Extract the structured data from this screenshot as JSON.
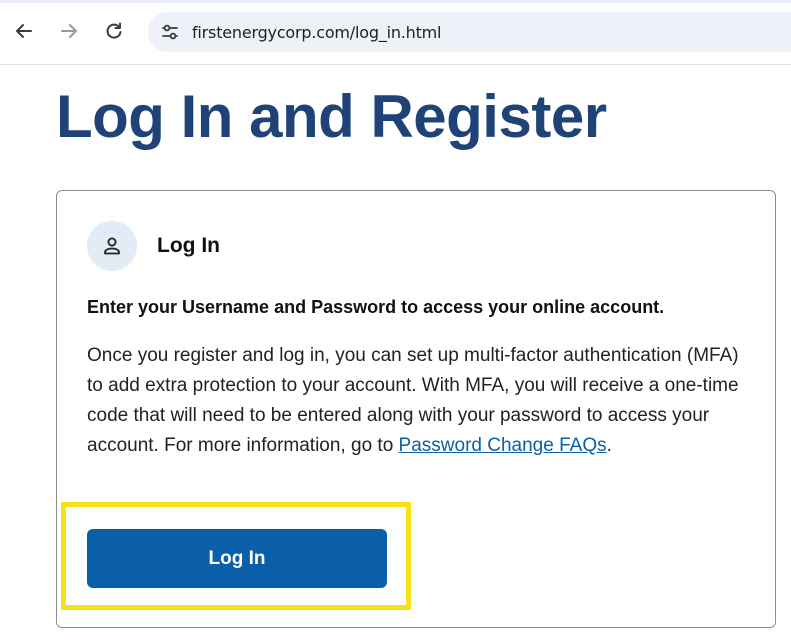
{
  "browser": {
    "url": "firstenergycorp.com/log_in.html",
    "icons": [
      "back-icon",
      "forward-icon",
      "reload-icon",
      "site-info-icon"
    ]
  },
  "page": {
    "title": "Log In and Register"
  },
  "card": {
    "icon": "user-icon",
    "heading": "Log In",
    "subheading": "Enter your Username and Password to access your online account.",
    "body_text": "Once you register and log in, you can set up multi-factor authentication (MFA) to add extra protection to your account. With MFA, you will receive a one-time code that will need to be entered along with your password to access your account. For more information, go to ",
    "link_text": "Password Change FAQs",
    "body_end": ".",
    "button_label": "Log In"
  },
  "colors": {
    "title": "#1f4277",
    "button": "#0a5fa8",
    "link": "#0b5fa5",
    "highlight": "#f7e21a"
  }
}
